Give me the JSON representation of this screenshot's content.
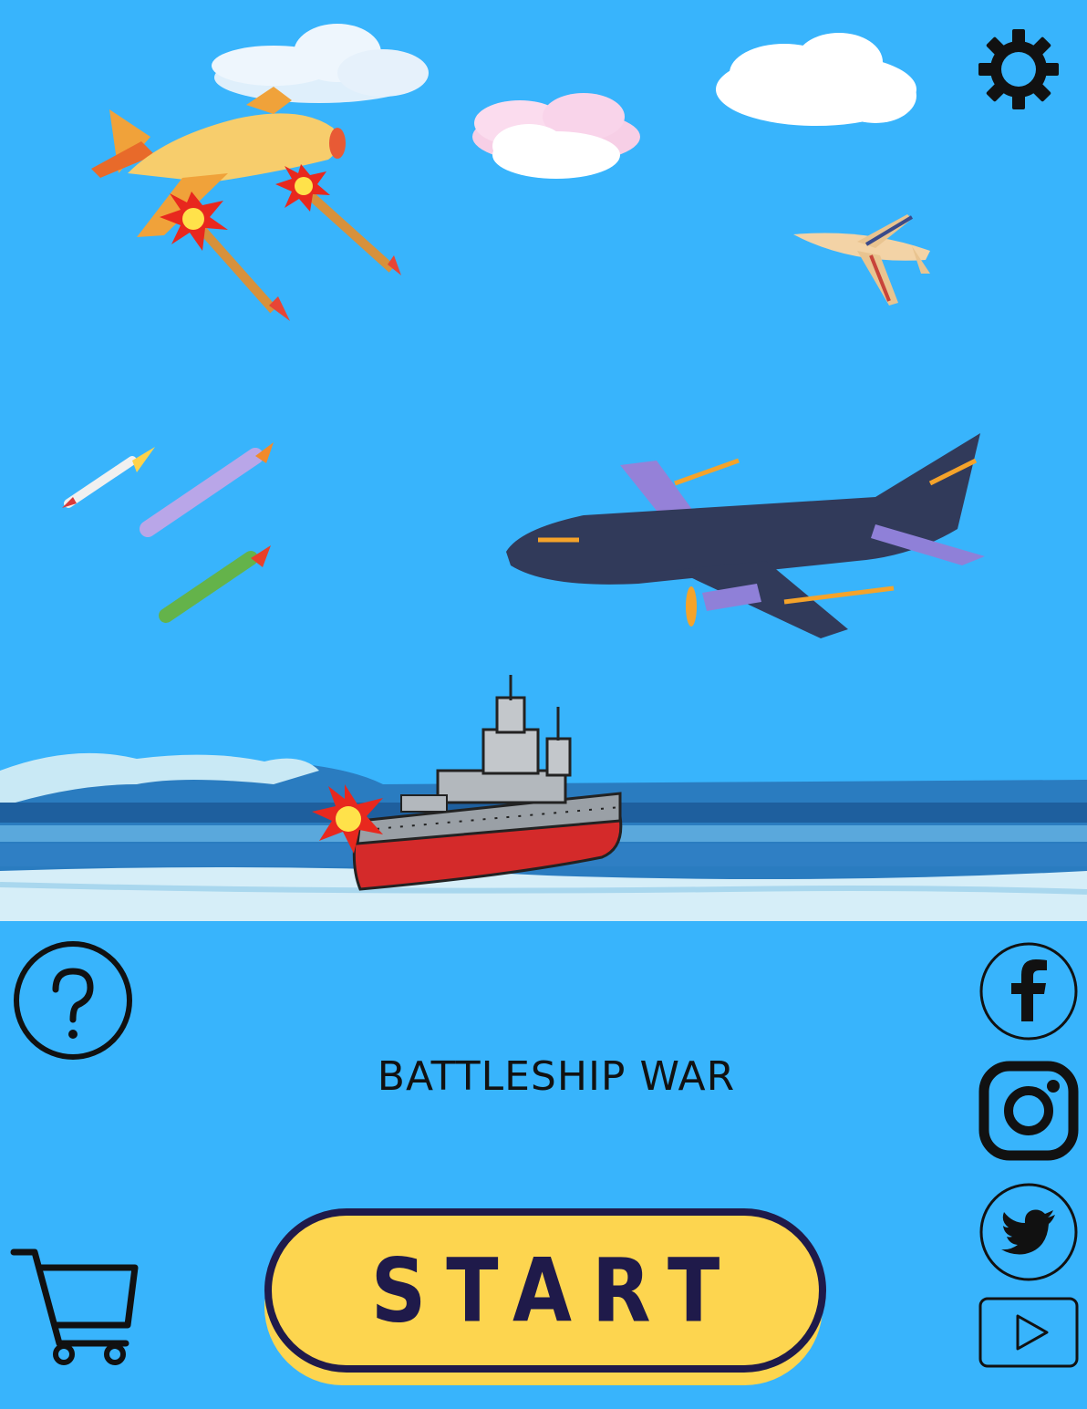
{
  "title": "BATTLESHIP WAR",
  "start_label": "START",
  "icons": {
    "settings": "gear-icon",
    "help": "question-icon",
    "cart": "cart-icon",
    "facebook": "facebook-icon",
    "instagram": "instagram-icon",
    "twitter": "twitter-icon",
    "youtube": "play-icon"
  },
  "colors": {
    "sky": "#38b4fc",
    "button_fill": "#fdd54f",
    "button_border": "#1f1a4a",
    "ship_hull": "#d42a2a"
  }
}
